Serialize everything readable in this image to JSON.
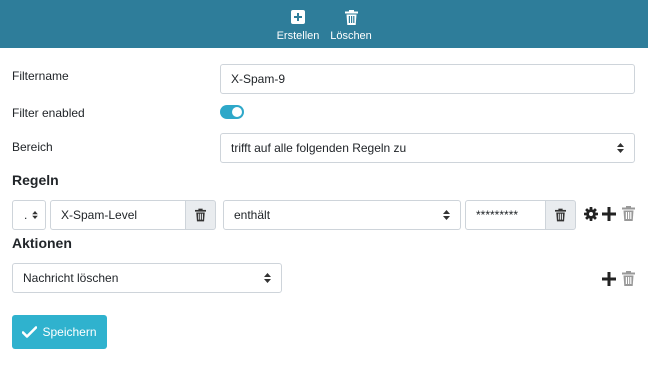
{
  "toolbar": {
    "create_label": "Erstellen",
    "create_icon": "plus-square-icon",
    "delete_label": "Löschen",
    "delete_icon": "trash-icon",
    "background_color": "#2e7d9a"
  },
  "form": {
    "filtername_label": "Filtername",
    "filtername_value": "X-Spam-9",
    "enabled_label": "Filter enabled",
    "enabled_value": true,
    "bereich_label": "Bereich",
    "bereich_value": "trifft auf alle folgenden Regeln zu"
  },
  "rules": {
    "heading": "Regeln",
    "items": [
      {
        "prefix": ".",
        "header": "X-Spam-Level",
        "operator": "enthält",
        "value": "*********"
      }
    ]
  },
  "actions": {
    "heading": "Aktionen",
    "items": [
      {
        "action": "Nachricht löschen"
      }
    ]
  },
  "save": {
    "label": "Speichern",
    "icon": "check-icon",
    "color": "#2fb2ce"
  },
  "colors": {
    "toggle_on": "#2ea8c9",
    "icon_dark": "#333333",
    "icon_grey": "#999999"
  }
}
